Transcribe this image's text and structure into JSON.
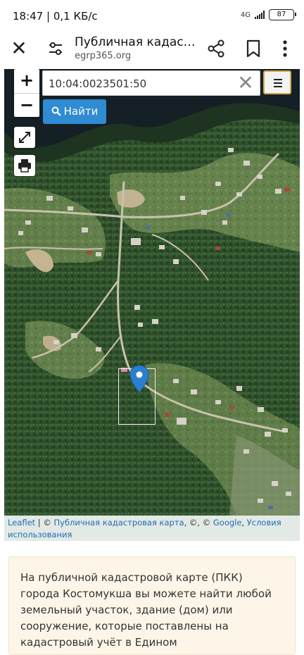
{
  "status_bar": {
    "time_speed": "18:47 | 0,1 КБ/с",
    "network": "4G",
    "battery": "87"
  },
  "toolbar": {
    "title": "Публичная кадастровая карта",
    "url": "egrp365.org",
    "icons": [
      "close-icon",
      "tune-icon",
      "share-icon",
      "bookmark-icon",
      "more-vert-icon"
    ]
  },
  "map": {
    "zoom_in": "+",
    "zoom_out": "−",
    "search_value": "10:04:0023501:50",
    "clear": "✕",
    "find_label": "Найти",
    "icons": [
      "fullscreen-icon",
      "print-icon",
      "menu-icon",
      "map-marker-icon"
    ]
  },
  "attribution": {
    "leaflet": "Leaflet",
    "sep1": " | © ",
    "pkk": "Публичная кадастровая карта",
    "sep2": ", ©, © ",
    "google": "Google",
    "sep3": ", ",
    "terms": "Условия использования"
  },
  "info": {
    "text": "На публичной кадастровой карте (ПКК) города Костомукша вы можете найти любой земельный участок, здание (дом) или сооружение, которые поставлены на кадастровый учёт в Едином"
  },
  "colors": {
    "find_button": "#2f8bd2",
    "menu_border": "#d7a94a",
    "marker": "#2a7fd0",
    "info_bg": "#fdf6e8"
  }
}
